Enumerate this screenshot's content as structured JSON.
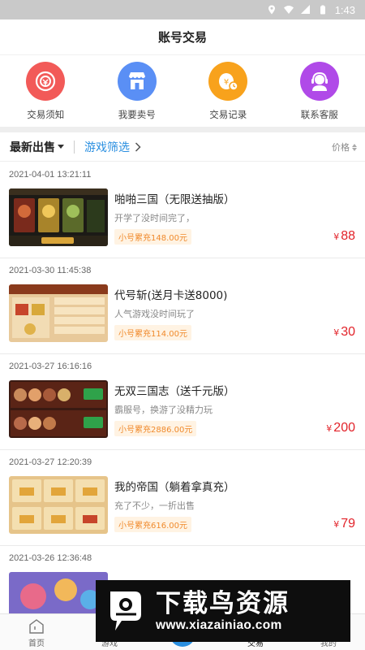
{
  "status_bar": {
    "time": "1:43"
  },
  "header": {
    "title": "账号交易"
  },
  "quick_actions": [
    {
      "label": "交易须知",
      "icon": "trade-notice-icon",
      "color": "#f25a58"
    },
    {
      "label": "我要卖号",
      "icon": "shop-icon",
      "color": "#5a8ff5"
    },
    {
      "label": "交易记录",
      "icon": "coin-record-icon",
      "color": "#f8a21c"
    },
    {
      "label": "联系客服",
      "icon": "customer-service-icon",
      "color": "#b04ae8"
    }
  ],
  "filter": {
    "latest": "最新出售",
    "game_filter": "游戏筛选",
    "price": "价格"
  },
  "listings": [
    {
      "time": "2021-04-01 13:21:11",
      "title": "啪啪三国（无限送抽版）",
      "desc": "开学了没时间完了，",
      "recharge": "小号累充148.00元",
      "yen": "¥",
      "price": "88"
    },
    {
      "time": "2021-03-30 11:45:38",
      "title": "代号斩(送月卡送8000)",
      "desc": "人气游戏没时间玩了",
      "recharge": "小号累充114.00元",
      "yen": "¥",
      "price": "30"
    },
    {
      "time": "2021-03-27 16:16:16",
      "title": "无双三国志（送千元版）",
      "desc": "霸服号，换游了没精力玩",
      "recharge": "小号累充2886.00元",
      "yen": "¥",
      "price": "200"
    },
    {
      "time": "2021-03-27 12:20:39",
      "title": "我的帝国（躺着拿真充）",
      "desc": "充了不少，一折出售",
      "recharge": "小号累充616.00元",
      "yen": "¥",
      "price": "79"
    },
    {
      "time": "2021-03-26 12:36:48",
      "title": "",
      "desc": "",
      "recharge": "",
      "yen": "",
      "price": ""
    }
  ],
  "bottom_nav": [
    {
      "label": "首页",
      "icon": "home-icon",
      "active": false
    },
    {
      "label": "游戏",
      "icon": "game-icon",
      "active": false
    },
    {
      "label": "",
      "icon": "center-icon",
      "active": false
    },
    {
      "label": "交易",
      "icon": "trade-icon",
      "active": true
    },
    {
      "label": "我的",
      "icon": "profile-icon",
      "active": false
    }
  ],
  "watermark": {
    "name": "下载鸟资源",
    "url": "www.xiazainiao.com"
  },
  "colors": {
    "accent_blue": "#2a8fe0",
    "price_red": "#e2232a",
    "recharge_orange": "#f08a2c"
  }
}
